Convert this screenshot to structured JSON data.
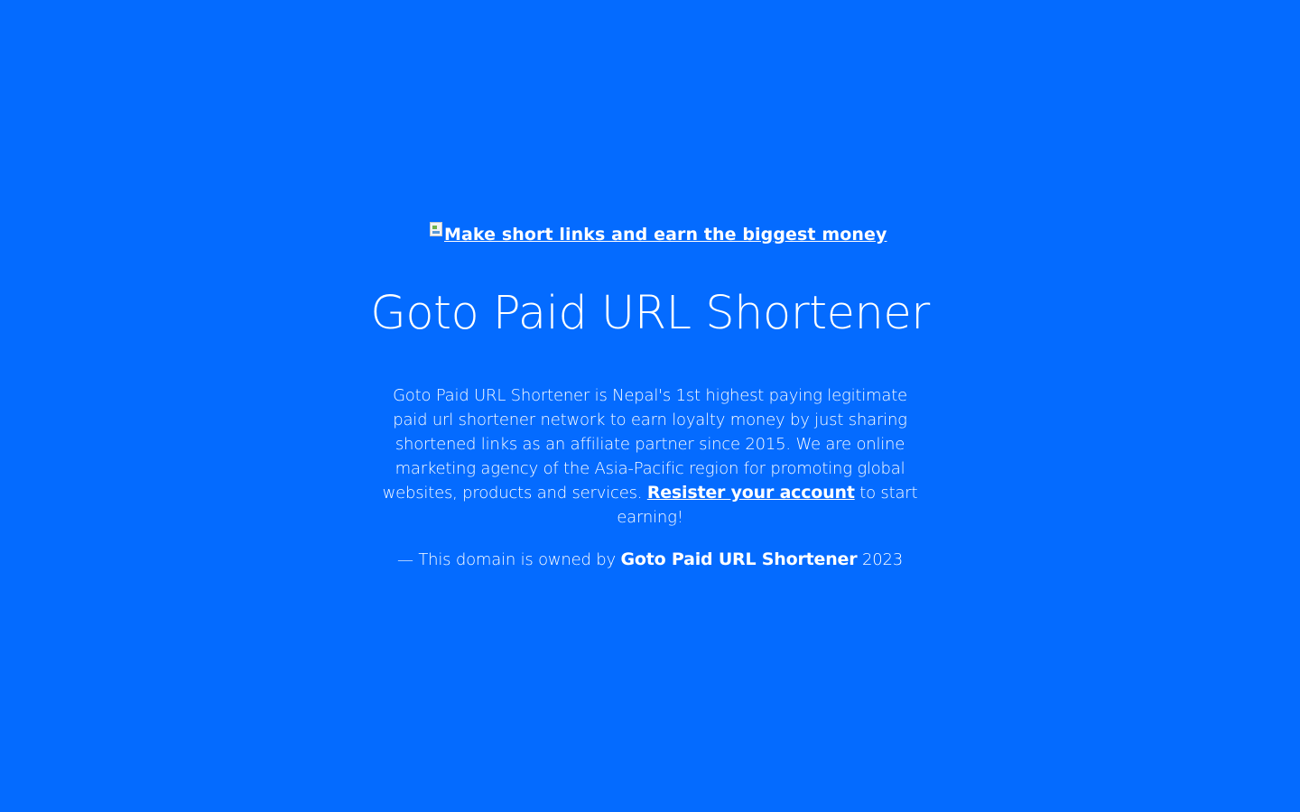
{
  "logo": {
    "alt_text": "Make short links and earn the biggest money"
  },
  "main": {
    "title": "Goto Paid URL Shortener",
    "description_text": "Goto Paid URL Shortener is Nepal's 1st highest paying legitimate paid url shortener network to earn loyalty money by just sharing shortened links as an affiliate partner since 2015. We are online marketing agency of the Asia-Pacific region for promoting global websites, products and services.",
    "register_link_label": "Resister your account",
    "description_suffix": "to start earning!"
  },
  "footer": {
    "owner_prefix": "— This domain is owned by",
    "owner_name": "Goto Paid URL Shortener",
    "owner_year": "2023"
  },
  "colors": {
    "background": "#046bff",
    "text": "#ffffff"
  },
  "icons": {
    "logo_image": "broken-image-icon"
  }
}
